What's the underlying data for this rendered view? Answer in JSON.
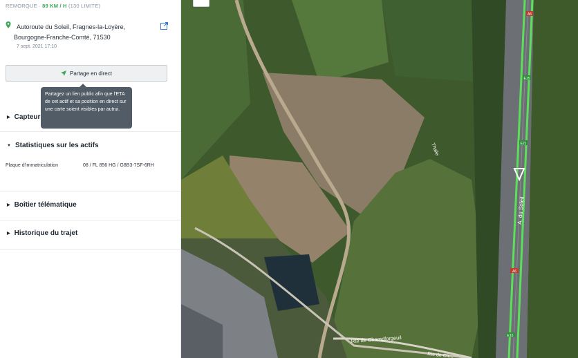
{
  "asset": {
    "type_label": "REMORQUE",
    "separator": "·",
    "speed": "89 KM / H",
    "limit": "(130 LIMITE)"
  },
  "location": {
    "line1": "Autoroute du Soleil, Fragnes-la-Loyère,",
    "line2": "Bourgogne-Franche-Comté, 71530",
    "timestamp": "7 sept. 2021 17:10"
  },
  "share": {
    "label": "Partage en direct",
    "tooltip": "Partagez un lien public afin que l'ETA de cet actif et sa position en direct sur une carte soient visibles par autrui."
  },
  "sections": {
    "sensors": "Capteurs",
    "stats": "Statistiques sur les actifs",
    "telematics": "Boîtier télématique",
    "history": "Historique du trajet"
  },
  "stats": {
    "plate_label": "Plaque d'immatriculation",
    "plate_value": "08 / FL 856 HG / G8B3-7SF-6RH"
  },
  "map": {
    "labels": {
      "road_a": "A. du Soleil",
      "road_thalie": "Thalie",
      "road_champ": "Rte de Champforgeuil",
      "road_champ2": "Rte de Ch...",
      "shield_a6_top": "A6",
      "shield_e15_1": "E15",
      "shield_e21": "E21",
      "shield_a6_mid": "A6",
      "shield_e15_2": "E15"
    }
  },
  "colors": {
    "speed_green": "#3aa655",
    "route_green": "#5ce05c",
    "tooltip_bg": "#525c66"
  }
}
